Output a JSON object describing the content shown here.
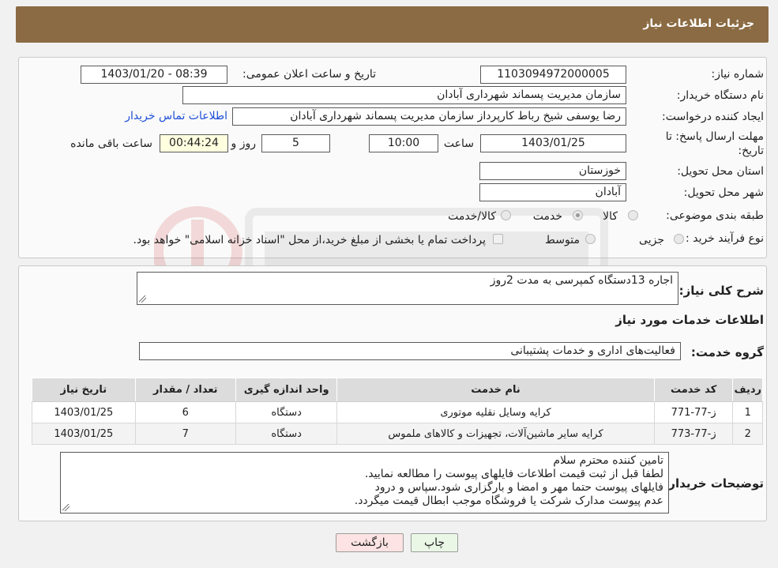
{
  "header": {
    "title": "جزئیات اطلاعات نیاز"
  },
  "form": {
    "need_number_label": "شماره نیاز:",
    "need_number": "1103094972000005",
    "announce_label": "تاریخ و ساعت اعلان عمومی:",
    "announce_value": "1403/01/20 - 08:39",
    "buyer_org_label": "نام دستگاه خریدار:",
    "buyer_org": "سازمان مدیریت پسماند شهرداری آبادان",
    "creator_label": "ایجاد کننده درخواست:",
    "creator": "رضا یوسفی شیخ رباط کارپرداز سازمان مدیریت پسماند شهرداری آبادان",
    "contact_link": "اطلاعات تماس خریدار",
    "deadline_label_1": "مهلت ارسال پاسخ: تا",
    "deadline_label_2": "تاریخ:",
    "deadline_date": "1403/01/25",
    "time_label": "ساعت",
    "deadline_time": "10:00",
    "days_value": "5",
    "days_label": "روز و",
    "remaining_time": "00:44:24",
    "remaining_label": "ساعت باقی مانده",
    "province_label": "استان محل تحویل:",
    "province": "خوزستان",
    "city_label": "شهر محل تحویل:",
    "city": "آبادان",
    "category_label": "طبقه بندی موضوعی:",
    "category_options": [
      "کالا",
      "خدمت",
      "کالا/خدمت"
    ],
    "process_label": "نوع فرآیند خرید :",
    "process_options": [
      "جزیی",
      "متوسط"
    ],
    "payment_note": "پرداخت تمام یا بخشی از مبلغ خرید،از محل \"اسناد خزانه اسلامی\" خواهد بود."
  },
  "details": {
    "summary_label": "شرح کلی نیاز:",
    "summary": "اجاره 13دستگاه کمپرسی به مدت 2روز",
    "services_title": "اطلاعات خدمات مورد نیاز",
    "group_label": "گروه خدمت:",
    "group": "فعالیت‌های اداری و خدمات پشتیبانی",
    "table": {
      "headers": [
        "ردیف",
        "کد خدمت",
        "نام خدمت",
        "واحد اندازه گیری",
        "تعداد / مقدار",
        "تاریخ نیاز"
      ],
      "rows": [
        [
          "1",
          "ز-77-771",
          "کرایه وسایل نقلیه موتوری",
          "دستگاه",
          "6",
          "1403/01/25"
        ],
        [
          "2",
          "ز-77-773",
          "کرایه سایر ماشین‌آلات، تجهیزات و کالاهای ملموس",
          "دستگاه",
          "7",
          "1403/01/25"
        ]
      ]
    },
    "buyer_notes_label": "توضیحات خریدار:",
    "buyer_notes": [
      "تامین کننده محترم سلام",
      "لطفا قبل از ثبت قیمت اطلاعات فایلهای پیوست را مطالعه نمایید.",
      "فایلهای پیوست حتما مهر و امضا و بارگزاری شود.سپاس و درود",
      "عدم پیوست مدارک شرکت یا فروشگاه موجب ابطال قیمت میگردد."
    ]
  },
  "buttons": {
    "print": "چاپ",
    "back": "بازگشت"
  },
  "colors": {
    "header_bg": "#8b6b43",
    "back_button_bg": "#fde3e3",
    "print_button_bg": "#eaf7e6",
    "link": "#1f4fd8"
  }
}
